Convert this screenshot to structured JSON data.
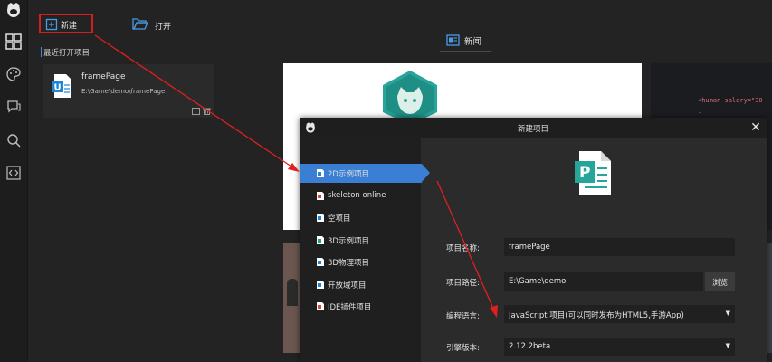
{
  "sidebar": {
    "icons": [
      "grid-icon",
      "palette-icon",
      "chat-icon",
      "search-icon",
      "code-icon"
    ]
  },
  "toolbar": {
    "new_label": "新建",
    "open_label": "打开"
  },
  "recent": {
    "header": "最近打开项目",
    "items": [
      {
        "name": "framePage",
        "path": "E:\\Game\\demo\\framePage"
      }
    ]
  },
  "news": {
    "tab_label": "新闻",
    "code_preview": [
      "<human salary=\"30",
      "."
    ]
  },
  "dialog": {
    "title": "新建项目",
    "close": "✕",
    "project_types": [
      {
        "label": "2D示例项目",
        "selected": true
      },
      {
        "label": "skeleton online"
      },
      {
        "label": "空项目"
      },
      {
        "label": "3D示例项目"
      },
      {
        "label": "3D物理项目"
      },
      {
        "label": "开放域项目"
      },
      {
        "label": "IDE插件项目"
      }
    ],
    "form": {
      "name_label": "项目名称:",
      "name_value": "framePage",
      "path_label": "项目路径:",
      "path_value": "E:\\Game\\demo",
      "browse_label": "浏览",
      "lang_label": "编程语言:",
      "lang_value": "JavaScript 项目(可以同时发布为HTML5,手游App)",
      "engine_label": "引擎版本:",
      "engine_value": "2.12.2beta"
    }
  },
  "colors": {
    "accent": "#3a7fd4",
    "annotation": "#d51f1f",
    "logo_teal": "#27a59a"
  }
}
